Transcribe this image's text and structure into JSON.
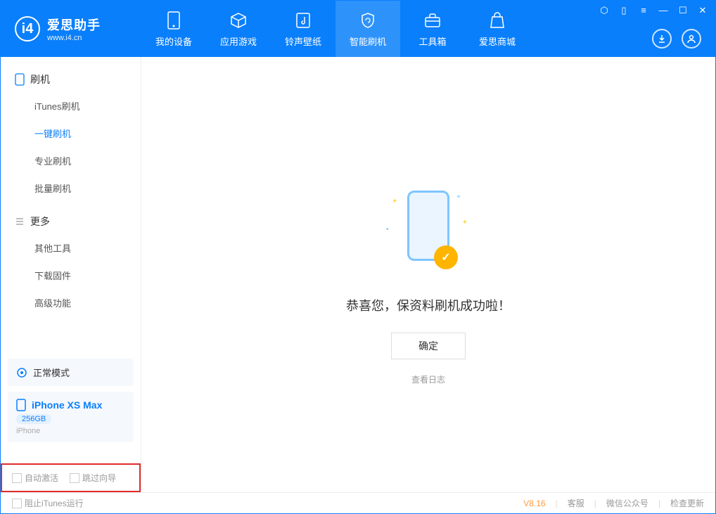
{
  "app": {
    "title": "爱思助手",
    "url": "www.i4.cn"
  },
  "nav": [
    {
      "label": "我的设备"
    },
    {
      "label": "应用游戏"
    },
    {
      "label": "铃声壁纸"
    },
    {
      "label": "智能刷机"
    },
    {
      "label": "工具箱"
    },
    {
      "label": "爱思商城"
    }
  ],
  "sidebar": {
    "section1": "刷机",
    "items1": [
      {
        "label": "iTunes刷机"
      },
      {
        "label": "一键刷机"
      },
      {
        "label": "专业刷机"
      },
      {
        "label": "批量刷机"
      }
    ],
    "section2": "更多",
    "items2": [
      {
        "label": "其他工具"
      },
      {
        "label": "下载固件"
      },
      {
        "label": "高级功能"
      }
    ],
    "mode": "正常模式",
    "device": {
      "name": "iPhone XS Max",
      "storage": "256GB",
      "type": "iPhone"
    }
  },
  "options": {
    "auto_activate": "自动激活",
    "skip_guide": "跳过向导"
  },
  "main": {
    "success_text": "恭喜您，保资料刷机成功啦！",
    "ok_button": "确定",
    "view_log": "查看日志"
  },
  "footer": {
    "block_itunes": "阻止iTunes运行",
    "version": "V8.16",
    "support": "客服",
    "wechat": "微信公众号",
    "update": "检查更新"
  }
}
